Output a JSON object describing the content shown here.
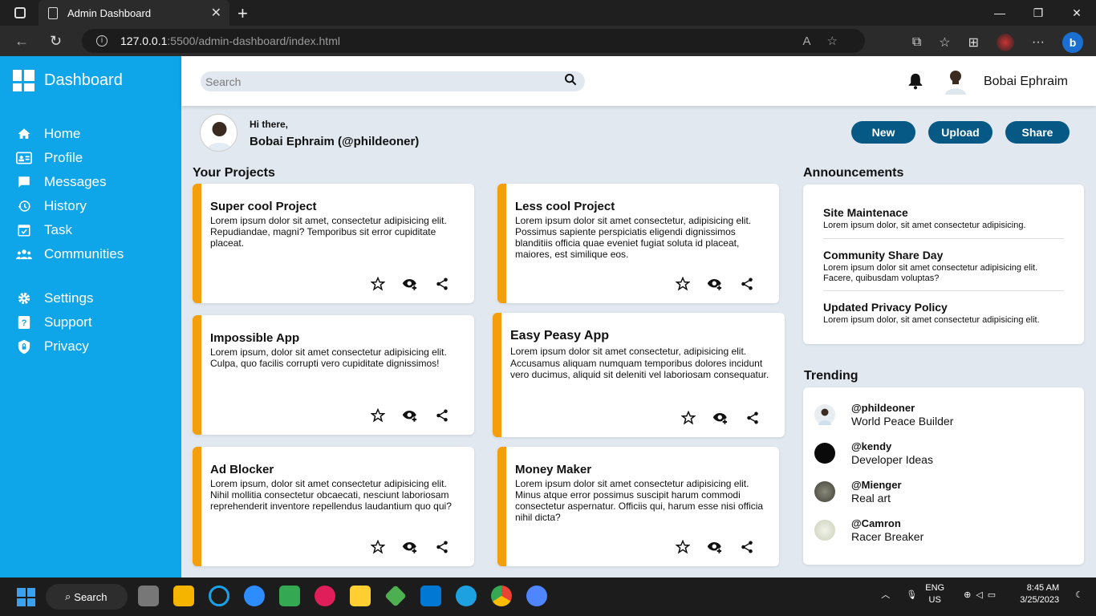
{
  "browser": {
    "tab_title": "Admin Dashboard",
    "url_host": "127.0.0.1",
    "url_path": ":5500/admin-dashboard/index.html"
  },
  "sidebar": {
    "brand": "Dashboard",
    "items": [
      {
        "label": "Home",
        "icon": "home-icon"
      },
      {
        "label": "Profile",
        "icon": "id-card-icon"
      },
      {
        "label": "Messages",
        "icon": "message-icon"
      },
      {
        "label": "History",
        "icon": "history-icon"
      },
      {
        "label": "Task",
        "icon": "calendar-check-icon"
      },
      {
        "label": "Communities",
        "icon": "users-icon"
      },
      {
        "label": "Settings",
        "icon": "gear-icon"
      },
      {
        "label": "Support",
        "icon": "question-icon"
      },
      {
        "label": "Privacy",
        "icon": "shield-icon"
      }
    ]
  },
  "header": {
    "search_placeholder": "Search",
    "user_name": "Bobai Ephraim"
  },
  "greeting": {
    "hi": "Hi there,",
    "handle": "Bobai Ephraim (@phildeoner)"
  },
  "actions": {
    "new": "New",
    "upload": "Upload",
    "share": "Share"
  },
  "projects": {
    "title": "Your Projects",
    "cards": [
      {
        "title": "Super cool Project",
        "text": "Lorem ipsum dolor sit amet, consectetur adipisicing elit. Repudiandae, magni? Temporibus sit error cupiditate placeat."
      },
      {
        "title": "Less cool Project",
        "text": "Lorem ipsum dolor sit amet consectetur, adipisicing elit. Possimus sapiente perspiciatis eligendi dignissimos blanditiis officia quae eveniet fugiat soluta id placeat, maiores, est similique eos."
      },
      {
        "title": "Impossible App",
        "text": "Lorem ipsum, dolor sit amet consectetur adipisicing elit. Culpa, quo facilis corrupti vero cupiditate dignissimos!"
      },
      {
        "title": "Easy Peasy App",
        "text": "Lorem ipsum dolor sit amet consectetur, adipisicing elit. Accusamus aliquam numquam temporibus dolores incidunt vero ducimus, aliquid sit deleniti vel laboriosam consequatur."
      },
      {
        "title": "Ad Blocker",
        "text": "Lorem ipsum, dolor sit amet consectetur adipisicing elit. Nihil mollitia consectetur obcaecati, nesciunt laboriosam reprehenderit inventore repellendus laudantium quo qui?"
      },
      {
        "title": "Money Maker",
        "text": "Lorem ipsum dolor sit amet consectetur adipisicing elit. Minus atque error possimus suscipit harum commodi consectetur aspernatur. Officiis qui, harum esse nisi officia nihil dicta?"
      }
    ]
  },
  "announcements": {
    "title": "Announcements",
    "items": [
      {
        "title": "Site Maintenace",
        "text": "Lorem ipsum dolor, sit amet consectetur adipisicing."
      },
      {
        "title": "Community Share Day",
        "text": "Lorem ipsum dolor sit amet consectetur adipisicing elit. Facere, quibusdam voluptas?"
      },
      {
        "title": "Updated Privacy Policy",
        "text": "Lorem ipsum dolor, sit amet consectetur adipisicing elit."
      }
    ]
  },
  "trending": {
    "title": "Trending",
    "items": [
      {
        "handle": "@phildeoner",
        "desc": "World Peace Builder"
      },
      {
        "handle": "@kendy",
        "desc": "Developer Ideas"
      },
      {
        "handle": "@Mienger",
        "desc": "Real art"
      },
      {
        "handle": "@Camron",
        "desc": "Racer Breaker"
      }
    ]
  },
  "taskbar": {
    "search": "Search",
    "lang1": "ENG",
    "lang2": "US",
    "time": "8:45 AM",
    "date": "3/25/2023"
  },
  "colors": {
    "sidebar": "#0ea5e9",
    "accent": "#f59e0b",
    "button": "#075985"
  }
}
